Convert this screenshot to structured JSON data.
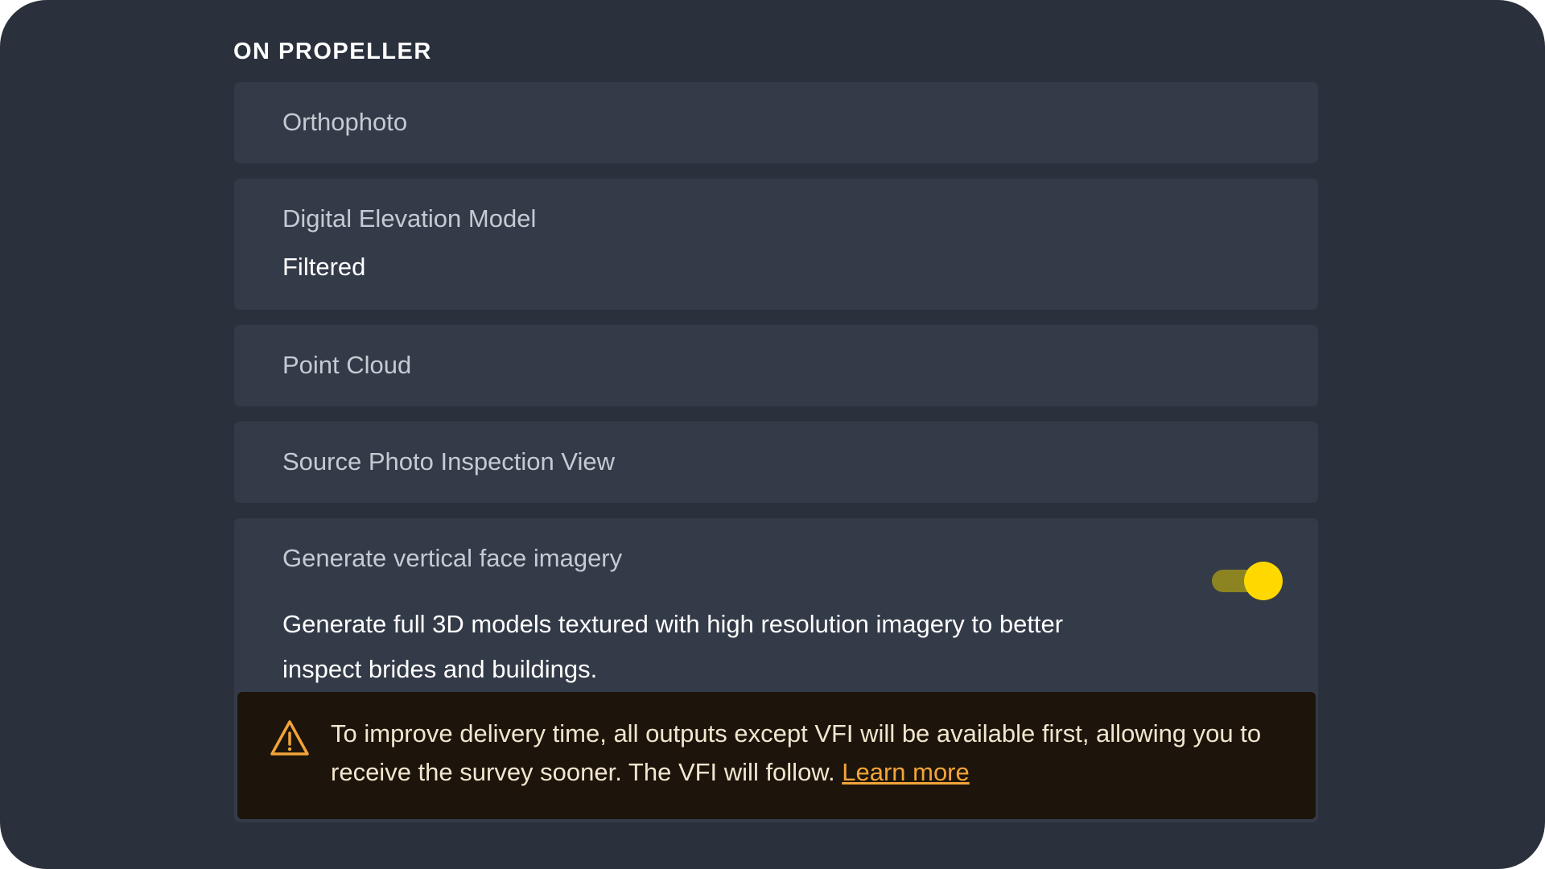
{
  "section": {
    "title": "ON PROPELLER"
  },
  "outputs": {
    "orthophoto": {
      "label": "Orthophoto"
    },
    "dem": {
      "label": "Digital Elevation Model",
      "value": "Filtered"
    },
    "point_cloud": {
      "label": "Point Cloud"
    },
    "source_photo": {
      "label": "Source Photo Inspection View"
    },
    "vfi": {
      "label": "Generate vertical face imagery",
      "description": "Generate full 3D models textured with high resolution imagery to better inspect brides and buildings.",
      "enabled": true
    }
  },
  "warning": {
    "icon": "warning-triangle-icon",
    "text": "To improve delivery time, all outputs except VFI will be available first, allowing you to receive the survey sooner. The VFI will follow. ",
    "link_label": "Learn more"
  },
  "colors": {
    "background": "#2b313c",
    "card": "#343b48",
    "accent": "#ffd800",
    "warning_bg": "#1d150b",
    "warning_icon": "#f2a43a",
    "link": "#f2a43a"
  }
}
